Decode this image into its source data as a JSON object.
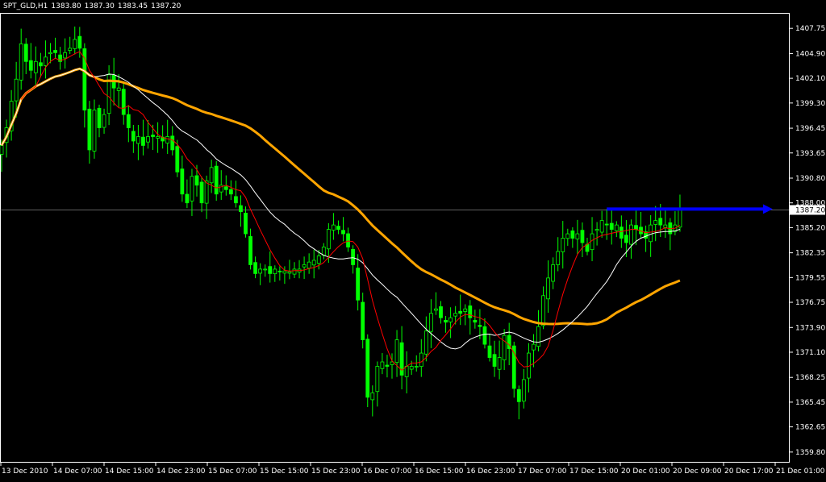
{
  "header": {
    "symbol": "SPT_GLD,H1",
    "open": "1383.80",
    "high": "1387.30",
    "low": "1383.45",
    "close": "1387.20"
  },
  "colors": {
    "background": "#000000",
    "frame": "#ffffff",
    "candle": "#00ff00",
    "ma_fast": "#ff0000",
    "ma_mid": "#ffffff",
    "ma_slow": "#ffa500",
    "trend_arrow": "#0000ff",
    "price_line": "#c0c0c0"
  },
  "chart_data": {
    "type": "candlestick",
    "ylim": [
      1358.6,
      1409.5
    ],
    "grid": false,
    "y_ticks": [
      "1407.75",
      "1404.90",
      "1402.10",
      "1399.30",
      "1396.45",
      "1393.65",
      "1390.80",
      "1388.00",
      "1385.20",
      "1382.35",
      "1379.55",
      "1376.75",
      "1373.90",
      "1371.10",
      "1368.25",
      "1365.45",
      "1362.65",
      "1359.80"
    ],
    "x_ticks": [
      "13 Dec 2010",
      "14 Dec 07:00",
      "14 Dec 15:00",
      "14 Dec 23:00",
      "15 Dec 07:00",
      "15 Dec 15:00",
      "15 Dec 23:00",
      "16 Dec 07:00",
      "16 Dec 15:00",
      "16 Dec 23:00",
      "17 Dec 07:00",
      "17 Dec 15:00",
      "20 Dec 01:00",
      "20 Dec 09:00",
      "20 Dec 17:00",
      "21 Dec 01:00"
    ],
    "current_price_label": "1387.20",
    "current_price": 1387.2,
    "trend_arrow": {
      "from_bar": 124,
      "to_bar": 158,
      "price": 1387.3
    },
    "candles_close": [
      1394.5,
      1396.5,
      1399.5,
      1402,
      1406,
      1404,
      1403,
      1404,
      1403.5,
      1404.5,
      1405,
      1405,
      1404,
      1405,
      1405.5,
      1406.5,
      1405.5,
      1398.5,
      1394,
      1398.5,
      1396.5,
      1398,
      1402.5,
      1401,
      1401,
      1398,
      1396.5,
      1395,
      1395.5,
      1394.5,
      1395.5,
      1395.5,
      1395.5,
      1395,
      1395.5,
      1394,
      1391.5,
      1389,
      1388,
      1391,
      1390,
      1388,
      1390.5,
      1392,
      1389,
      1390,
      1389.5,
      1389,
      1388,
      1387,
      1384.5,
      1381,
      1380,
      1380.5,
      1380.5,
      1380,
      1380.5,
      1380.2,
      1380.3,
      1380.2,
      1380.5,
      1380.5,
      1381,
      1381.3,
      1381.5,
      1382,
      1383,
      1385,
      1385.5,
      1385,
      1384.5,
      1383,
      1381,
      1377,
      1372.5,
      1366,
      1366.5,
      1369.5,
      1370,
      1369.5,
      1370,
      1372.5,
      1368.5,
      1369.5,
      1369.5,
      1369.5,
      1371,
      1373.5,
      1375.5,
      1376,
      1375,
      1374.5,
      1375,
      1375.5,
      1375.5,
      1376,
      1375,
      1374.5,
      1374,
      1372,
      1370.5,
      1369.5,
      1370.5,
      1373,
      1371.5,
      1367,
      1365.5,
      1368,
      1371,
      1372,
      1374,
      1377.5,
      1379.5,
      1381,
      1382.5,
      1384,
      1384.5,
      1384,
      1384.5,
      1383.5,
      1382.5,
      1384.5,
      1385,
      1386,
      1385.5,
      1385,
      1385.5,
      1384,
      1383.5,
      1385.5,
      1385,
      1384.5,
      1384,
      1385.5,
      1386,
      1385.5,
      1385.5,
      1384.5,
      1385.5,
      1387.2
    ],
    "series": [
      {
        "name": "MA fast",
        "values": []
      },
      {
        "name": "MA mid",
        "values": []
      },
      {
        "name": "MA slow",
        "values": []
      }
    ]
  }
}
